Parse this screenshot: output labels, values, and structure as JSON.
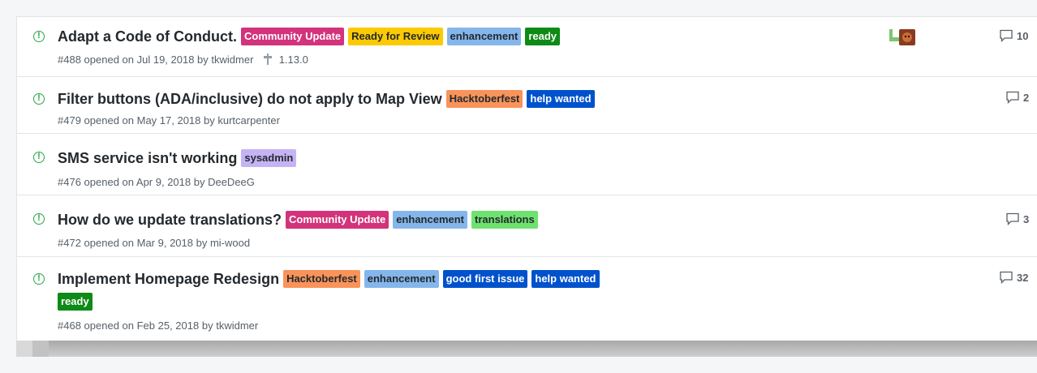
{
  "issues": [
    {
      "title": "Adapt a Code of Conduct.",
      "labels": [
        {
          "name": "Community Update",
          "bg": "#d2337a",
          "fg": "#ffffff"
        },
        {
          "name": "Ready for Review",
          "bg": "#fbca04",
          "fg": "#24292e"
        },
        {
          "name": "enhancement",
          "bg": "#84b6eb",
          "fg": "#24292e"
        },
        {
          "name": "ready",
          "bg": "#0e8a16",
          "fg": "#ffffff"
        }
      ],
      "number": "#488",
      "opened_text": "opened on Jul 19, 2018 by",
      "author": "tkwidmer",
      "milestone": "1.13.0",
      "comments": "10"
    },
    {
      "title": "Filter buttons (ADA/inclusive) do not apply to Map View",
      "labels": [
        {
          "name": "Hacktoberfest",
          "bg": "#f9935a",
          "fg": "#24292e"
        },
        {
          "name": "help wanted",
          "bg": "#0052cc",
          "fg": "#ffffff"
        }
      ],
      "number": "#479",
      "opened_text": "opened on May 17, 2018 by",
      "author": "kurtcarpenter",
      "comments": "2"
    },
    {
      "title": "SMS service isn't working",
      "labels": [
        {
          "name": "sysadmin",
          "bg": "#c5b3f4",
          "fg": "#24292e"
        }
      ],
      "number": "#476",
      "opened_text": "opened on Apr 9, 2018 by",
      "author": "DeeDeeG"
    },
    {
      "title": "How do we update translations?",
      "labels": [
        {
          "name": "Community Update",
          "bg": "#d2337a",
          "fg": "#ffffff"
        },
        {
          "name": "enhancement",
          "bg": "#84b6eb",
          "fg": "#24292e"
        },
        {
          "name": "translations",
          "bg": "#6ee26e",
          "fg": "#24292e"
        }
      ],
      "number": "#472",
      "opened_text": "opened on Mar 9, 2018 by",
      "author": "mi-wood",
      "comments": "3"
    },
    {
      "title": "Implement Homepage Redesign",
      "labels": [
        {
          "name": "Hacktoberfest",
          "bg": "#f9935a",
          "fg": "#24292e"
        },
        {
          "name": "enhancement",
          "bg": "#84b6eb",
          "fg": "#24292e"
        },
        {
          "name": "good first issue",
          "bg": "#0052cc",
          "fg": "#ffffff"
        },
        {
          "name": "help wanted",
          "bg": "#0052cc",
          "fg": "#ffffff"
        }
      ],
      "extra_labels": [
        {
          "name": "ready",
          "bg": "#0e8a16",
          "fg": "#ffffff"
        }
      ],
      "number": "#468",
      "opened_text": "opened on Feb 25, 2018 by",
      "author": "tkwidmer",
      "comments": "32"
    }
  ],
  "icons": {
    "status": "issue-opened-icon",
    "comment": "comment-icon",
    "milestone": "milestone-icon"
  }
}
